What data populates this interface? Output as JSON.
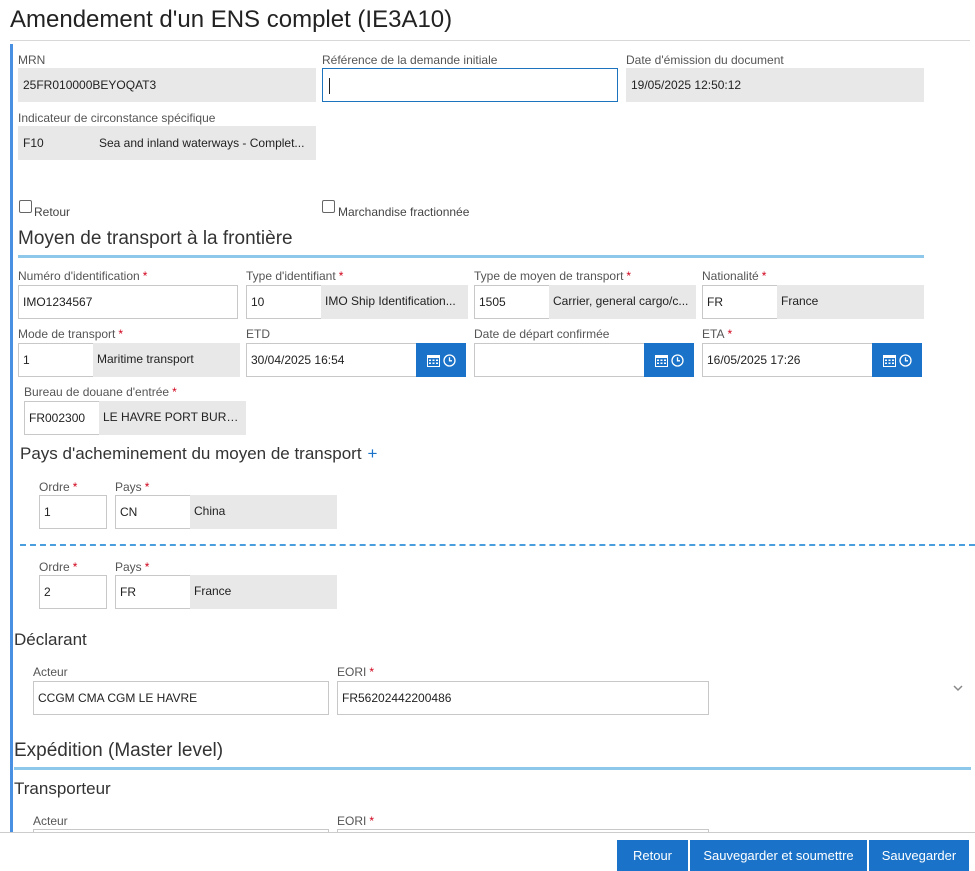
{
  "page": {
    "title": "Amendement d'un ENS complet (IE3A10)"
  },
  "header_fields": {
    "mrn": {
      "label": "MRN",
      "value": "25FR010000BEYOQAT3"
    },
    "reference": {
      "label": "Référence de la demande initiale",
      "value": ""
    },
    "date_emission": {
      "label": "Date d'émission du document",
      "value": "19/05/2025 12:50:12"
    },
    "indicateur": {
      "label": "Indicateur de circonstance spécifique",
      "code": "F10",
      "description": "Sea and inland waterways - Complet..."
    },
    "retour": {
      "label": "Retour"
    },
    "fractionnee": {
      "label": "Marchandise fractionnée"
    }
  },
  "transport": {
    "title": "Moyen de transport à la frontière",
    "numero": {
      "label": "Numéro d'identification",
      "value": "IMO1234567"
    },
    "type_id": {
      "label": "Type d'identifiant",
      "code": "10",
      "description": "IMO Ship Identification..."
    },
    "type_moyen": {
      "label": "Type de moyen de transport",
      "code": "1505",
      "description": "Carrier, general cargo/c..."
    },
    "nationalite": {
      "label": "Nationalité",
      "code": "FR",
      "description": "France"
    },
    "mode": {
      "label": "Mode de transport",
      "code": "1",
      "description": "Maritime transport"
    },
    "etd": {
      "label": "ETD",
      "value": "30/04/2025 16:54"
    },
    "date_depart": {
      "label": "Date de départ confirmée",
      "value": ""
    },
    "eta": {
      "label": "ETA",
      "value": "16/05/2025 17:26"
    },
    "bureau": {
      "label": "Bureau de douane d'entrée",
      "code": "FR002300",
      "description": "LE HAVRE PORT BUREAU"
    }
  },
  "pays_acheminement": {
    "title": "Pays d'acheminement du moyen de transport",
    "add_label": "+",
    "ordre_label": "Ordre",
    "pays_label": "Pays",
    "rows": [
      {
        "ordre": "1",
        "code": "CN",
        "description": "China"
      },
      {
        "ordre": "2",
        "code": "FR",
        "description": "France"
      }
    ]
  },
  "declarant": {
    "title": "Déclarant",
    "acteur": {
      "label": "Acteur",
      "value": "CCGM CMA CGM LE HAVRE"
    },
    "eori": {
      "label": "EORI",
      "value": "FR56202442200486"
    }
  },
  "expedition": {
    "title": "Expédition (Master level)",
    "transporteur": {
      "title": "Transporteur",
      "acteur_label": "Acteur",
      "eori_label": "EORI"
    }
  },
  "required_mark": "*",
  "footer": {
    "retour": "Retour",
    "sauvegarder_soumettre": "Sauvegarder et soumettre",
    "sauvegarder": "Sauvegarder"
  },
  "colors": {
    "accent": "#1a73c9",
    "section_rule": "#8dc8ea",
    "readonly_bg": "#e8e8e8"
  }
}
